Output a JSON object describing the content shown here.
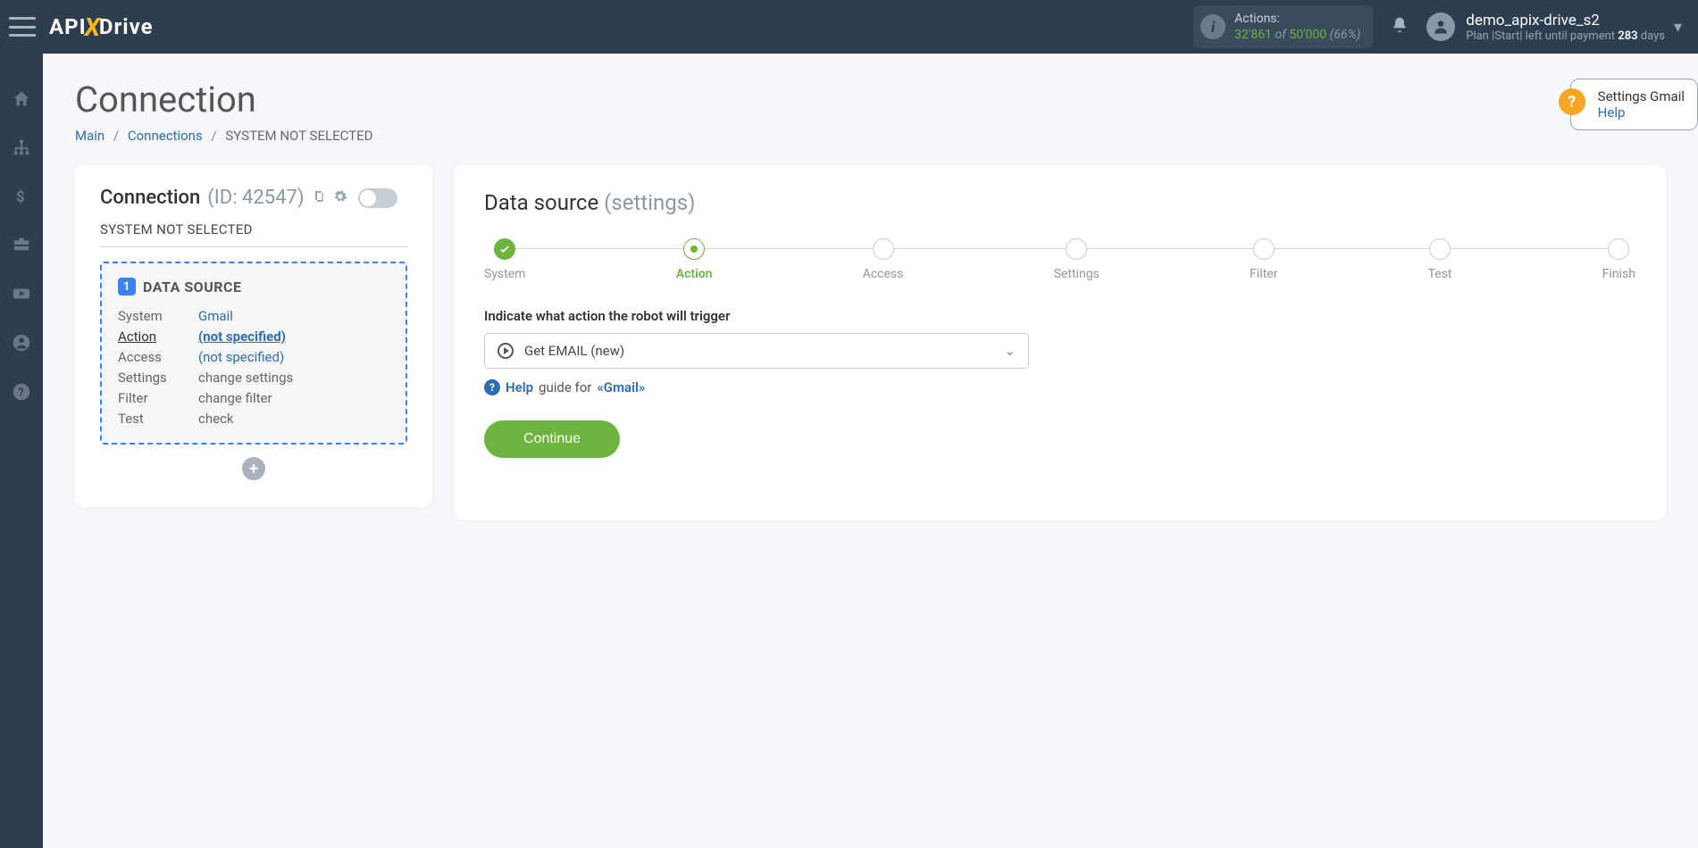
{
  "topbar": {
    "logo_left": "API",
    "logo_x": "X",
    "logo_right": "Drive",
    "actions_label": "Actions:",
    "actions_used": "32'861",
    "actions_of": "of",
    "actions_total": "50'000",
    "actions_pct": "(66%)",
    "user_name": "demo_apix-drive_s2",
    "plan_prefix": "Plan |Start| left until payment ",
    "plan_days_num": "283",
    "plan_days_suffix": " days"
  },
  "page": {
    "title": "Connection",
    "breadcrumbs": {
      "main": "Main",
      "connections": "Connections",
      "current": "SYSTEM NOT SELECTED"
    }
  },
  "help_card": {
    "title": "Settings Gmail",
    "link": "Help"
  },
  "left": {
    "title": "Connection",
    "id_label": "(ID: 42547)",
    "system_line": "SYSTEM NOT SELECTED",
    "ds_badge": "1",
    "ds_title": "DATA SOURCE",
    "rows": {
      "system_lbl": "System",
      "system_val": "Gmail",
      "action_lbl": "Action",
      "action_val": "(not specified)",
      "access_lbl": "Access",
      "access_val": "(not specified)",
      "settings_lbl": "Settings",
      "settings_val": "change settings",
      "filter_lbl": "Filter",
      "filter_val": "change filter",
      "test_lbl": "Test",
      "test_val": "check"
    }
  },
  "right": {
    "title": "Data source",
    "subtitle": "(settings)",
    "steps": [
      "System",
      "Action",
      "Access",
      "Settings",
      "Filter",
      "Test",
      "Finish"
    ],
    "field_label": "Indicate what action the robot will trigger",
    "select_value": "Get EMAIL (new)",
    "help_word": "Help",
    "guide_text": "guide for",
    "guide_target": "«Gmail»",
    "continue": "Continue"
  }
}
